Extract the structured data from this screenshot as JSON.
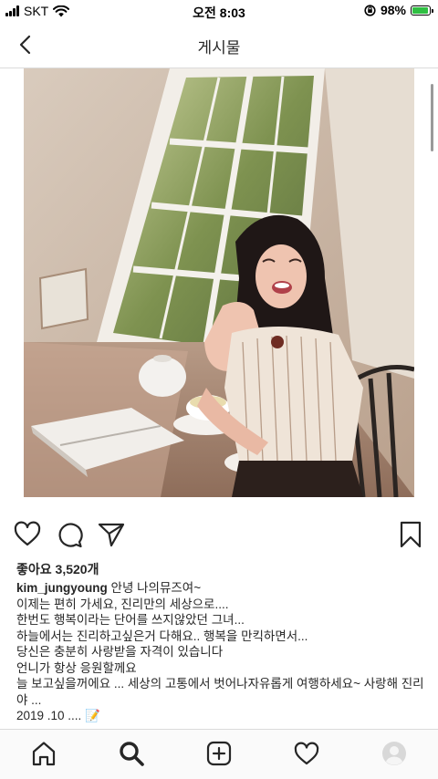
{
  "status_bar": {
    "carrier": "SKT",
    "time": "오전 8:03",
    "battery_percent": "98%",
    "battery_color": "#2fbf42",
    "icons": [
      "signal-icon",
      "wifi-icon",
      "orientation-lock-icon",
      "battery-icon"
    ]
  },
  "nav": {
    "title": "게시물",
    "back_icon": "chevron-left-icon"
  },
  "post": {
    "photo_icon": "post-photo",
    "actions": [
      "heart-icon",
      "comment-icon",
      "share-icon",
      "bookmark-icon"
    ],
    "likes_text": "좋아요 3,520개",
    "username": "kim_jungyoung",
    "caption_lines": [
      "안녕 나의뮤즈여~",
      "이제는 편히 가세요, 진리만의 세상으로....",
      "한번도 행복이라는 단어를 쓰지않았던 그녀...",
      "하늘에서는 진리하고싶은거 다해요.. 행복을 만킥하면서...",
      "당신은 충분히 사랑받을 자격이 있습니다",
      "언니가 항상 응원할께요",
      "늘 보고싶을꺼에요 ... 세상의 고통에서 벗어나자유롭게 여행하세요~ 사랑해 진리야 ...",
      "2019 .10 .... "
    ],
    "memo_emoji": "📝"
  },
  "tab_bar": {
    "items": [
      "home-icon",
      "search-icon",
      "new-post-icon",
      "activity-icon",
      "profile-avatar"
    ]
  }
}
